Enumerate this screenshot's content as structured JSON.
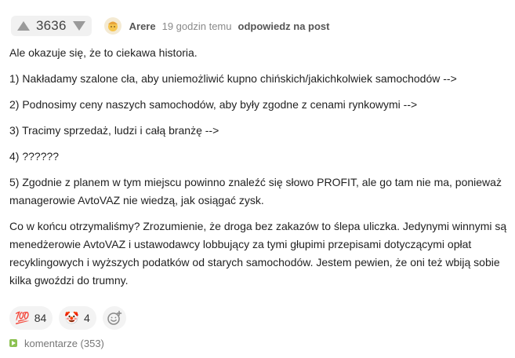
{
  "header": {
    "score": "3636",
    "username": "Arere",
    "time": "19 godzin temu",
    "reply_label": "odpowiedz na post"
  },
  "comment": {
    "paragraphs": [
      "Ale okazuje się, że to ciekawa historia.",
      "1) Nakładamy szalone cła, aby uniemożliwić kupno chińskich/jakichkolwiek samochodów -->",
      "2) Podnosimy ceny naszych samochodów, aby były zgodne z cenami rynkowymi -->",
      "3) Tracimy sprzedaż, ludzi i całą branżę -->",
      "4) ??????",
      "5) Zgodnie z planem w tym miejscu powinno znaleźć się słowo PROFIT, ale go tam nie ma, ponieważ managerowie AvtoVAZ nie wiedzą, jak osiągać zysk.",
      "Co w końcu otrzymaliśmy? Zrozumienie, że droga bez zakazów to ślepa uliczka. Jedynymi winnymi są menedżerowie AvtoVAZ i ustawodawcy lobbujący za tymi głupimi przepisami dotyczącymi opłat recyklingowych i wyższych podatków od starych samochodów. Jestem pewien, że oni też wbiją sobie kilka gwoździ do trumny."
    ]
  },
  "reactions": [
    {
      "icon": "hundred-points-icon",
      "glyph": "💯",
      "count": "84"
    },
    {
      "icon": "clown-face-icon",
      "glyph": "🤡",
      "count": "4"
    }
  ],
  "footer": {
    "comments_label": "komentarze (353)"
  },
  "colors": {
    "vote_bg": "#f1f1f1",
    "arrow": "#9a9a9a",
    "accent_green": "#8cc152",
    "reaction_bg": "#f3f3f3"
  }
}
